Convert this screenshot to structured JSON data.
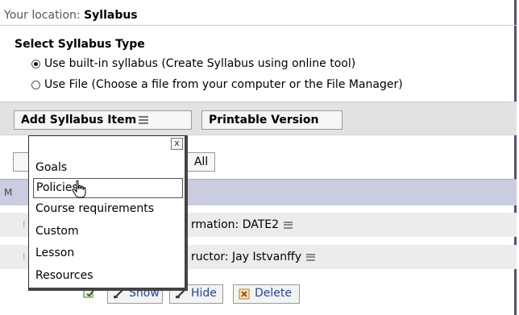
{
  "location": {
    "label": "Your location: ",
    "value": "Syllabus"
  },
  "syllabus_type": {
    "title": "Select Syllabus Type",
    "options": [
      {
        "label": "Use built-in syllabus  (Create Syllabus using online tool)",
        "checked": true
      },
      {
        "label": "Use File  (Choose a file from your computer or the File Manager)",
        "checked": false
      }
    ]
  },
  "toolbar": {
    "add_item_label": "Add Syllabus Item",
    "printable_label": "Printable Version"
  },
  "filter": {
    "all_label": "All"
  },
  "table": {
    "header_text": "M",
    "rows": [
      {
        "text": "rmation: DATE2"
      },
      {
        "text": "ructor: Jay Istvanffy"
      }
    ]
  },
  "actions": {
    "show_label": "Show",
    "hide_label": "Hide",
    "delete_label": "Delete"
  },
  "dropdown": {
    "close_label": "x",
    "items": [
      {
        "label": "Goals",
        "hover": false
      },
      {
        "label": "Policies",
        "hover": true
      },
      {
        "label": "Course requirements",
        "hover": false
      },
      {
        "label": "Custom",
        "hover": false
      },
      {
        "label": "Lesson",
        "hover": false
      },
      {
        "label": "Resources",
        "hover": false
      }
    ]
  },
  "colors": {
    "frame": "#5a4a80",
    "table_header": "#c8cedf",
    "link": "#2244aa"
  }
}
